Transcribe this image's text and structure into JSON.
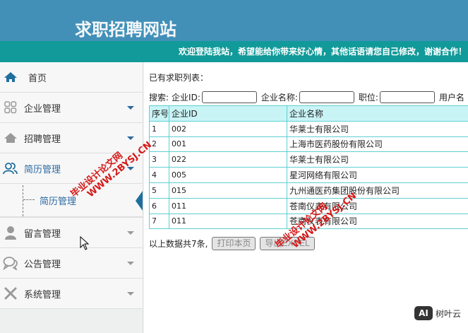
{
  "header": {
    "title": "求职招聘网站",
    "welcome": "欢迎登陆我站，希望能给你带来好心情，其他话语请您自己修改，谢谢合作！"
  },
  "sidebar": {
    "items": [
      {
        "label": "首页",
        "icon": "home-icon"
      },
      {
        "label": "企业管理",
        "icon": "grid-icon"
      },
      {
        "label": "招聘管理",
        "icon": "house-icon"
      },
      {
        "label": "简历管理",
        "icon": "users-icon"
      },
      {
        "label": "留言管理",
        "icon": "user-icon"
      },
      {
        "label": "公告管理",
        "icon": "chat-icon"
      },
      {
        "label": "系统管理",
        "icon": "tools-icon"
      }
    ],
    "sub_item": "简历管理"
  },
  "main": {
    "list_title": "已有求职列表：",
    "search": {
      "label": "搜索:",
      "company_id": "企业ID:",
      "company_name": "企业名称:",
      "position": "职位:",
      "username": "用户名"
    },
    "table": {
      "headers": [
        "序号",
        "企业ID",
        "企业名称"
      ],
      "rows": [
        [
          "1",
          "002",
          "华莱士有限公司"
        ],
        [
          "2",
          "001",
          "上海市医药股份有限公司"
        ],
        [
          "3",
          "022",
          "华莱士有限公司"
        ],
        [
          "4",
          "005",
          "星河网络有限公司"
        ],
        [
          "5",
          "015",
          "九州通医药集团股份有限公司"
        ],
        [
          "6",
          "011",
          "苍南仪表有限公司"
        ],
        [
          "7",
          "011",
          "苍南仪表有限公司"
        ]
      ]
    },
    "footer": {
      "count": "以上数据共7条,",
      "print": "打印本页",
      "export": "导出EXCEL"
    }
  },
  "watermark": {
    "line1": "毕业设计论文网",
    "line2": "WWW.2BYSJ.CN",
    "badge_ai": "AI",
    "badge_text": "树叶云"
  }
}
